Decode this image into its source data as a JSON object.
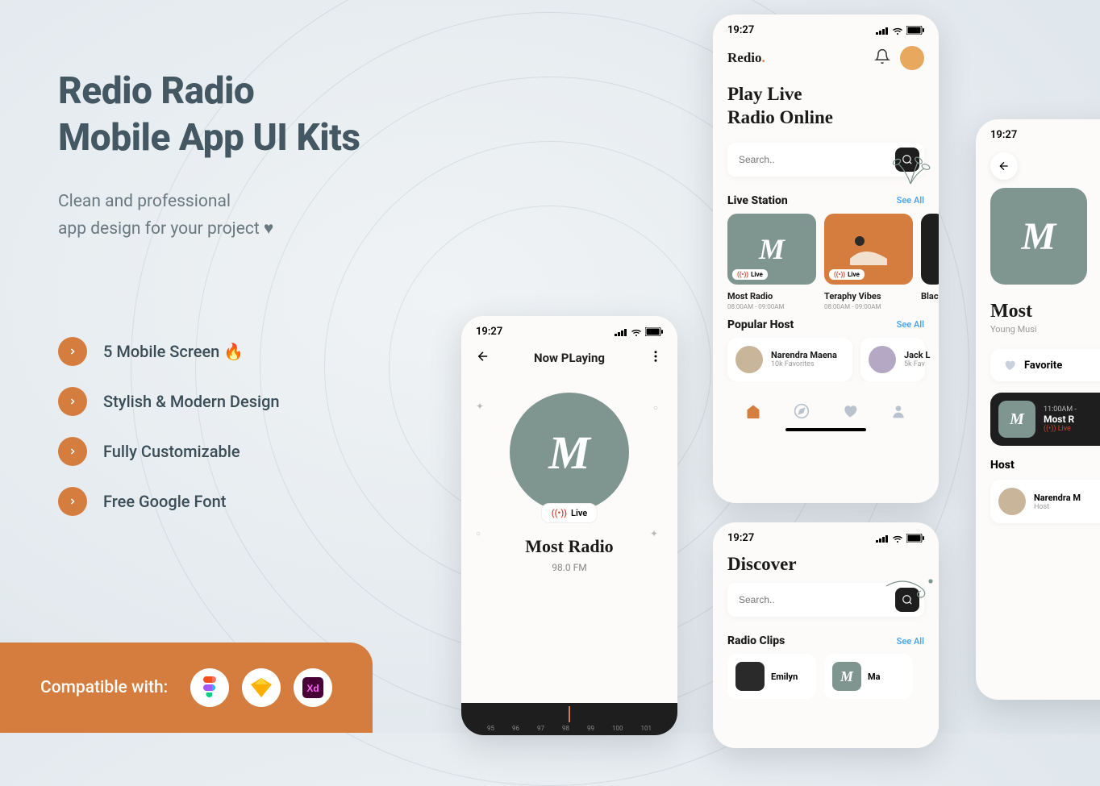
{
  "hero": {
    "title_l1": "Redio Radio",
    "title_l2": "Mobile App UI Kits",
    "tagline_l1": "Clean and professional",
    "tagline_l2": "app design for your project ♥"
  },
  "features": [
    {
      "label": "5 Mobile Screen 🔥"
    },
    {
      "label": "Stylish & Modern Design"
    },
    {
      "label": "Fully Customizable"
    },
    {
      "label": "Free Google Font"
    }
  ],
  "compat": {
    "label": "Compatible with:",
    "tools": [
      "Figma",
      "Sketch",
      "Adobe XD"
    ]
  },
  "status_time": "19:27",
  "phone1": {
    "title": "Now PLaying",
    "live": "Live",
    "station": "Most Radio",
    "freq": "98.0 FM",
    "ticks": [
      "95",
      "96",
      "97",
      "98",
      "99",
      "100",
      "101"
    ]
  },
  "phone2": {
    "brand": "Redio",
    "hero_l1": "Play Live",
    "hero_l2": "Radio Online",
    "search_placeholder": "Search..",
    "live_station_title": "Live Station",
    "see_all": "See All",
    "stations": [
      {
        "name": "Most Radio",
        "time": "08:00AM - 09:00AM",
        "live": "Live"
      },
      {
        "name": "Teraphy Vibes",
        "time": "08:00AM - 09:00AM",
        "live": "Live"
      },
      {
        "name": "Blac",
        "time": ""
      }
    ],
    "popular_host_title": "Popular Host",
    "hosts": [
      {
        "name": "Narendra Maena",
        "favs": "10k Favorites"
      },
      {
        "name": "Jack L",
        "favs": "5k Fav"
      }
    ]
  },
  "phone3": {
    "title": "Discover",
    "search_placeholder": "Search..",
    "radio_clips_title": "Radio Clips",
    "see_all": "See All",
    "clips": [
      {
        "name": "Emilyn"
      },
      {
        "name": "Ma"
      }
    ]
  },
  "phone4": {
    "station": "Most",
    "subtitle": "Young Musi",
    "favorite_label": "Favorite",
    "now": {
      "time": "11:00AM -",
      "name": "Most R",
      "live": "Live"
    },
    "host_title": "Host",
    "host": {
      "name": "Narendra M",
      "role": "Host"
    }
  }
}
